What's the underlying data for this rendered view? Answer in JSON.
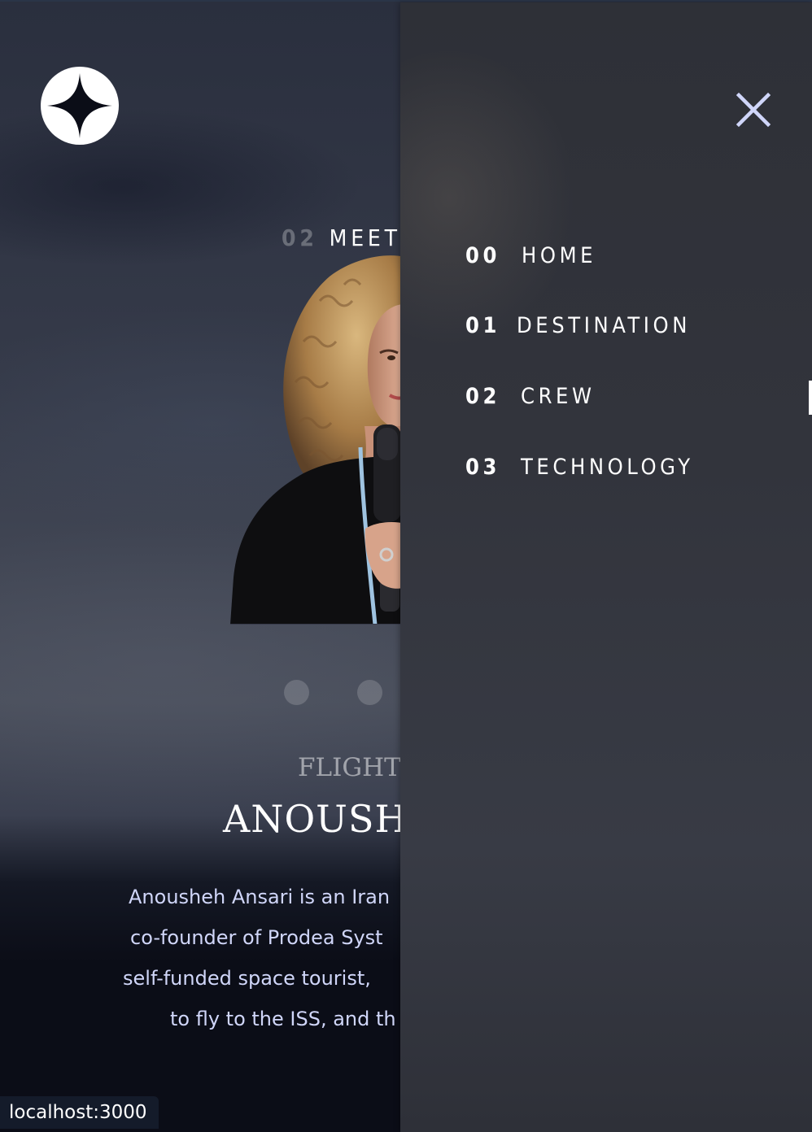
{
  "header": {
    "logo_icon": "star-logo-icon"
  },
  "crew_page": {
    "eyebrow_number": "02",
    "eyebrow_text": "MEET",
    "role": "FLIGHT E",
    "name": "ANOUSHE",
    "bio_lines": [
      "Anousheh Ansari is an Iran",
      "co-founder of Prodea Syst",
      "self-funded space tourist, ",
      "to fly to the ISS, and th"
    ],
    "portrait_alt": "crew-member-portrait",
    "carousel_dots": 2
  },
  "nav_drawer": {
    "close_icon": "close-icon",
    "items": [
      {
        "number": "00",
        "label": "HOME"
      },
      {
        "number": "01",
        "label": "DESTINATION"
      },
      {
        "number": "02",
        "label": "CREW"
      },
      {
        "number": "03",
        "label": "TECHNOLOGY"
      }
    ],
    "active_index": 2
  },
  "status_bar": {
    "url": "localhost:3000"
  },
  "colors": {
    "background": "#0b0d17",
    "drawer": "#32343c",
    "text": "#ffffff",
    "muted_text": "#d0d6f9",
    "close_icon": "#d0d6f9"
  }
}
